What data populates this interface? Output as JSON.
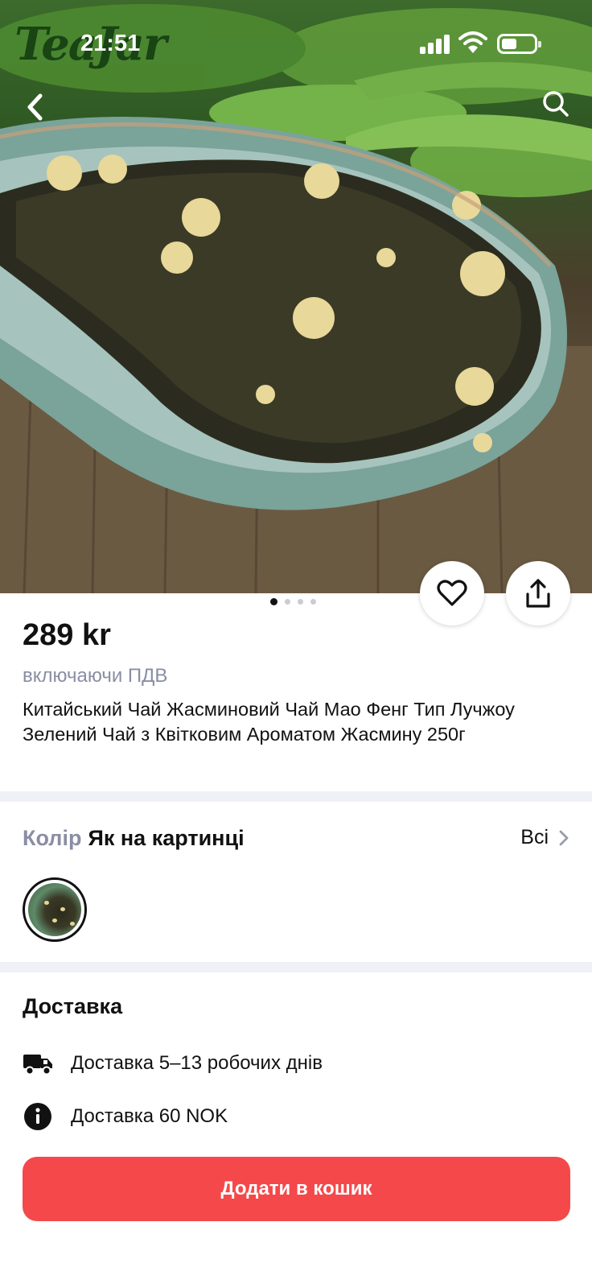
{
  "status_bar": {
    "time": "21:51",
    "icons": [
      "signal-icon",
      "wifi-icon",
      "battery-icon"
    ]
  },
  "hero": {
    "watermark_logo": "TeaJar",
    "image_subject": "jasmine green tea in a ceramic scoop",
    "carousel": {
      "count": 4,
      "active_index": 0
    }
  },
  "nav": {
    "back_icon": "chevron-left-icon",
    "search_icon": "search-icon"
  },
  "actions": {
    "favorite_icon": "heart-icon",
    "share_icon": "share-icon"
  },
  "product": {
    "price": "289 kr",
    "vat_note": "включаючи ПДВ",
    "title": "Китайський Чай Жасминовий Чай Мао Фенг Тип Лучжоу Зелений Чай з Квітковим Ароматом Жасмину 250г"
  },
  "variant": {
    "label": "Колір",
    "value": "Як на картинці",
    "all_link": "Всі",
    "chevron_icon": "chevron-right-icon"
  },
  "delivery": {
    "title": "Доставка",
    "items": [
      {
        "icon": "truck-icon",
        "text": "Доставка 5–13 робочих днів"
      },
      {
        "icon": "info-icon",
        "text": "Доставка 60 NOK"
      }
    ]
  },
  "cart_button": {
    "label": "Додати в кошик",
    "color": "#f5484a"
  },
  "colors": {
    "accent": "#f5484a",
    "muted_text": "#8a8ea3",
    "divider": "#f0f1f6"
  }
}
